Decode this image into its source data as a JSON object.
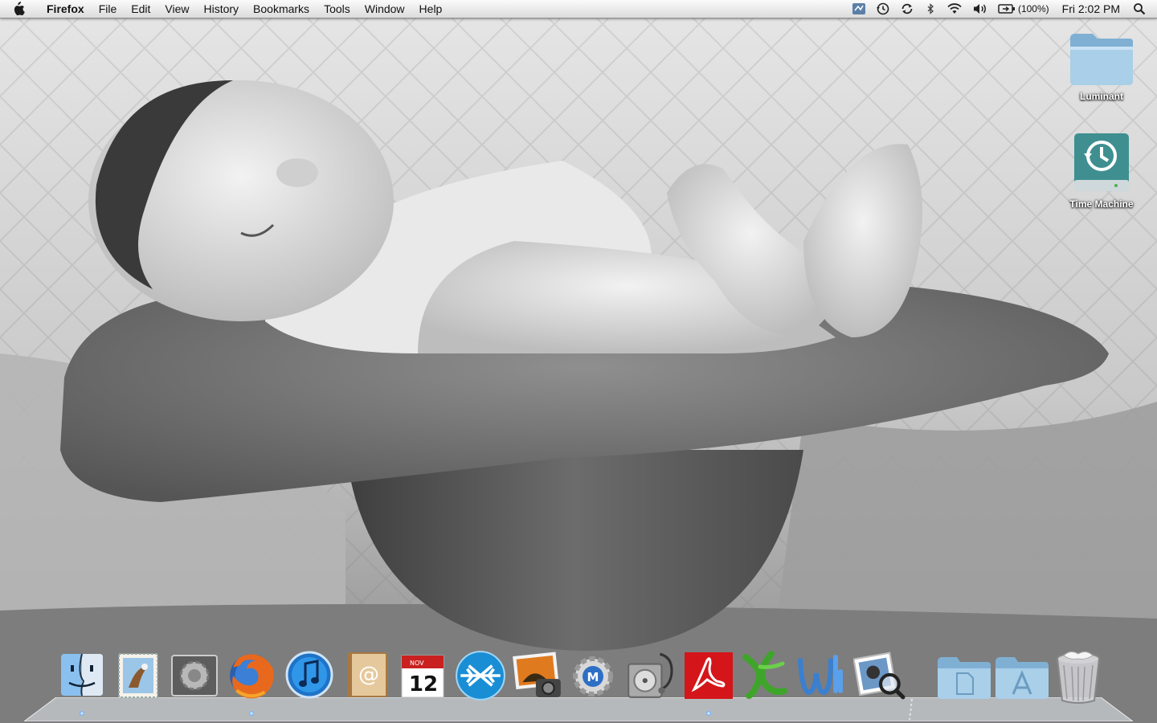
{
  "menubar": {
    "apple_icon": "apple-icon",
    "app_name": "Firefox",
    "menus": [
      "File",
      "Edit",
      "View",
      "History",
      "Bookmarks",
      "Tools",
      "Window",
      "Help"
    ],
    "status_icons": [
      "network-monitor-icon",
      "time-machine-icon",
      "sync-icon",
      "bluetooth-icon",
      "wifi-icon",
      "volume-icon",
      "battery-icon",
      "spotlight-icon"
    ],
    "battery_percent": "(100%)",
    "clock": "Fri 2:02 PM"
  },
  "desktop": {
    "icons": [
      {
        "name": "Luminant",
        "icon": "folder-icon"
      },
      {
        "name": "Time Machine",
        "icon": "time-machine-drive-icon"
      }
    ]
  },
  "dock": {
    "apps": [
      {
        "icon": "finder-icon",
        "running": true
      },
      {
        "icon": "mail-icon",
        "running": false
      },
      {
        "icon": "system-preferences-icon",
        "running": false
      },
      {
        "icon": "firefox-icon",
        "running": true
      },
      {
        "icon": "itunes-icon",
        "running": false
      },
      {
        "icon": "address-book-icon",
        "running": false
      },
      {
        "icon": "ical-icon",
        "running": false,
        "month": "NOV",
        "day": "12"
      },
      {
        "icon": "frostwire-icon",
        "running": false
      },
      {
        "icon": "iphoto-icon",
        "running": false
      },
      {
        "icon": "mainstage-utility-icon",
        "running": false
      },
      {
        "icon": "disk-utility-icon",
        "running": false
      },
      {
        "icon": "acrobat-reader-icon",
        "running": true
      },
      {
        "icon": "excel-icon",
        "running": false
      },
      {
        "icon": "word-icon",
        "running": false
      },
      {
        "icon": "preview-icon",
        "running": false
      }
    ],
    "stacks": [
      {
        "icon": "documents-stack-icon"
      },
      {
        "icon": "applications-stack-icon"
      }
    ],
    "trash": {
      "icon": "trash-icon"
    }
  },
  "colors": {
    "menubar_top": "#fbfbfb",
    "menubar_bottom": "#dcdcdc",
    "running_dot": "#6ab0ff",
    "folder_blue": "#9cc3df",
    "time_machine_teal": "#4a9a9c",
    "acrobat_red": "#d4151a",
    "office_green": "#3fa52a",
    "word_blue": "#3a7fd0"
  }
}
